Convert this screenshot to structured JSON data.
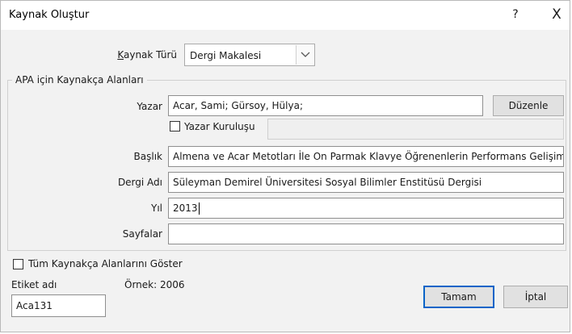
{
  "window": {
    "title": "Kaynak Oluştur",
    "help": "?",
    "close": "X"
  },
  "source_type": {
    "label": "Kaynak Türü",
    "value": "Dergi Makalesi"
  },
  "group_title": "APA için Kaynakça Alanları",
  "author": {
    "label": "Yazar",
    "value": "Acar, Sami; Gürsoy, Hülya;",
    "edit_button": "Düzenle"
  },
  "corporate_author": {
    "label": "Yazar Kuruluşu",
    "value": "",
    "checked": false
  },
  "title_field": {
    "label": "Başlık",
    "value": "Almena ve Acar Metotları İle On Parmak Klavye Öğrenenlerin Performans Gelişim Düzeyleri"
  },
  "journal": {
    "label": "Dergi Adı",
    "value": "Süleyman Demirel Üniversitesi Sosyal Bilimler Enstitüsü Dergisi"
  },
  "year": {
    "label": "Yıl",
    "value": "2013"
  },
  "pages": {
    "label": "Sayfalar",
    "value": ""
  },
  "show_all": {
    "label": "Tüm Kaynakça Alanlarını Göster",
    "checked": false
  },
  "tag": {
    "label": "Etiket adı",
    "value": "Aca131"
  },
  "example": "Örnek: 2006",
  "buttons": {
    "ok": "Tamam",
    "cancel": "İptal"
  }
}
